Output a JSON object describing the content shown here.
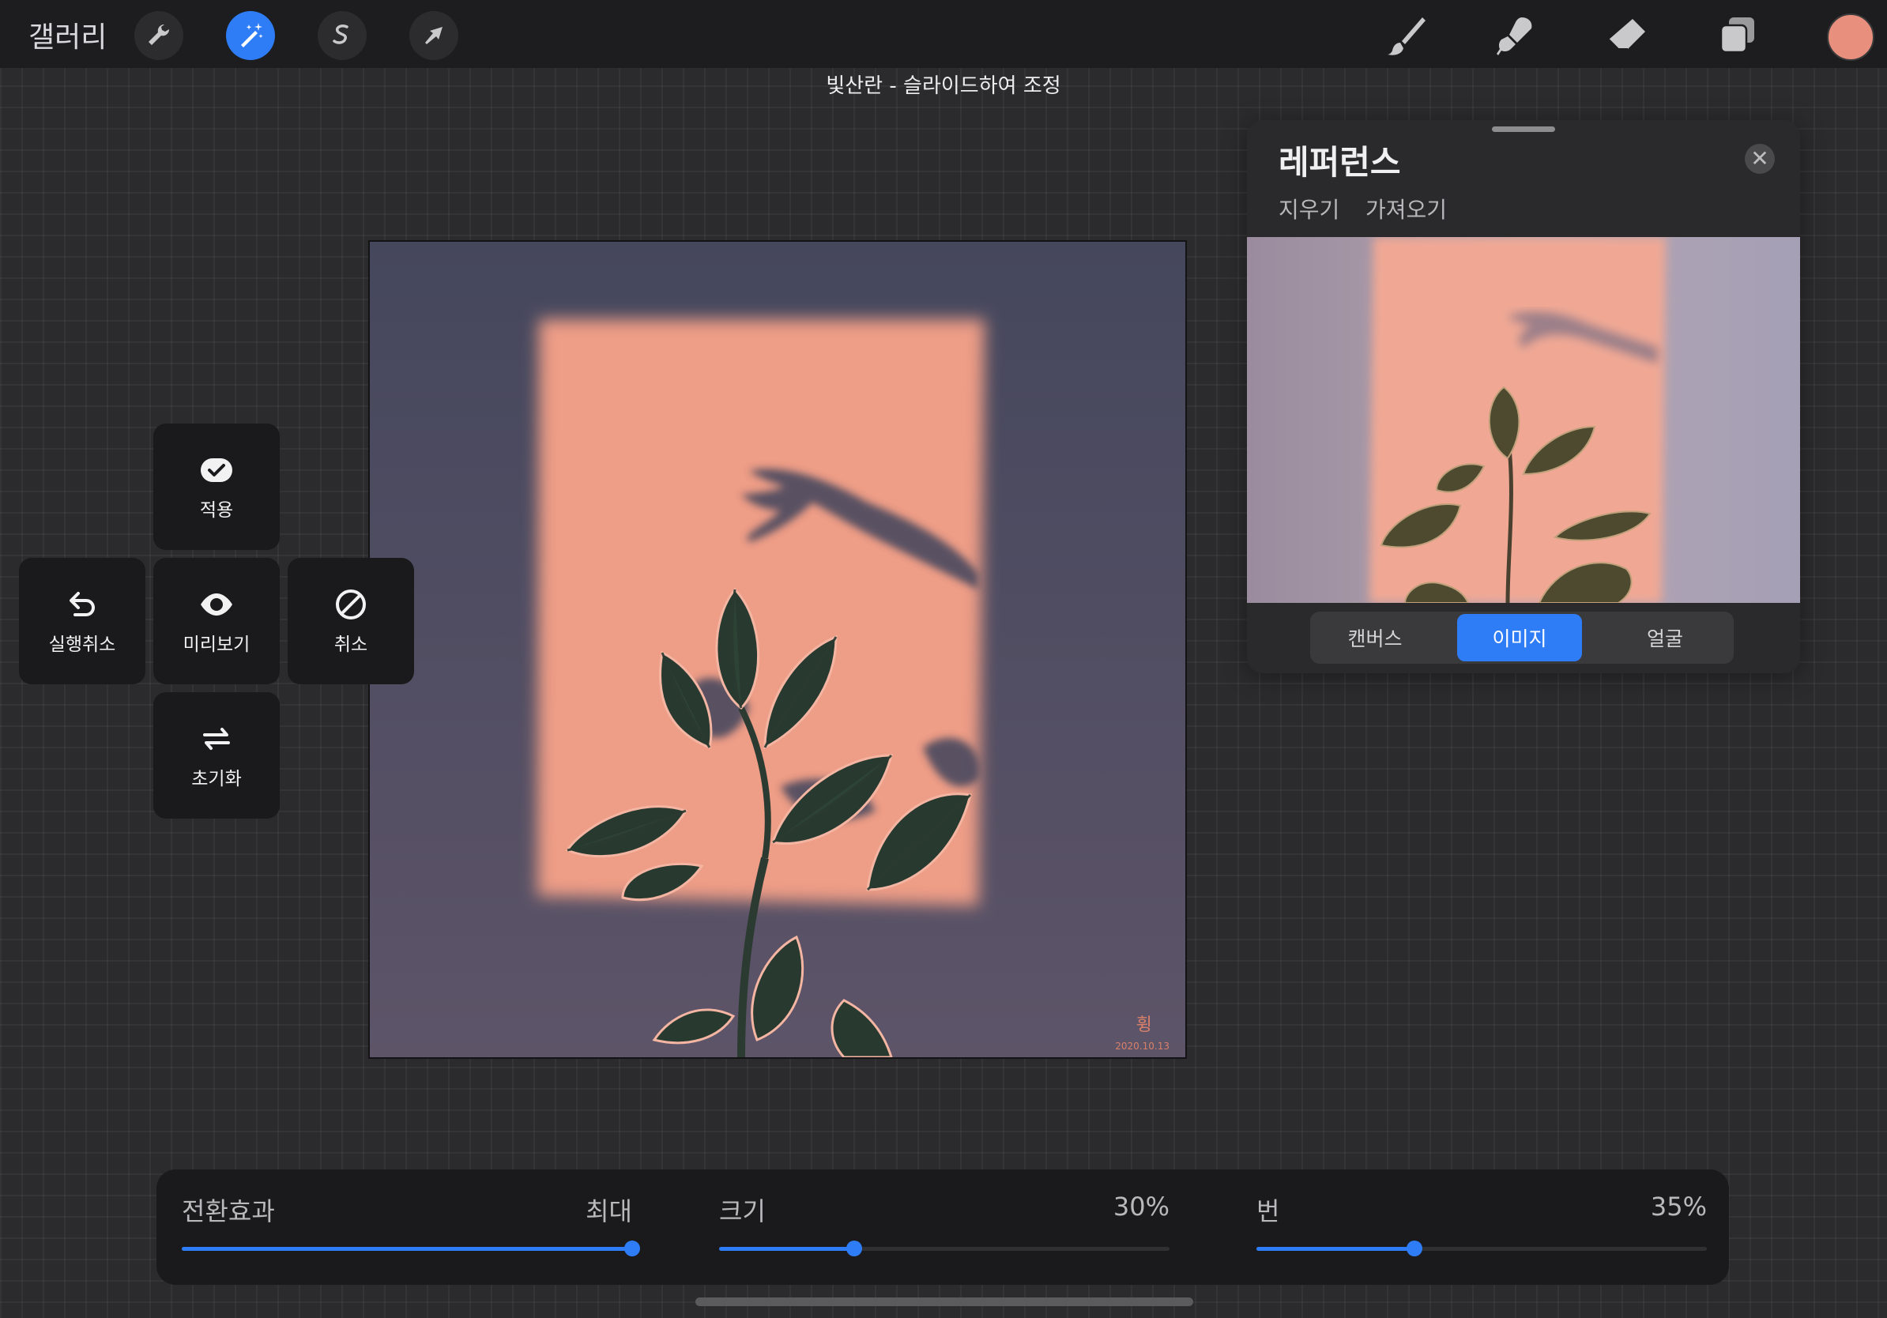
{
  "topbar": {
    "gallery_label": "갤러리",
    "tools": [
      "wrench-icon",
      "magic-wand-icon",
      "selection-icon",
      "transform-arrow-icon"
    ],
    "active_tool": "magic-wand-icon",
    "right_tools": [
      "brush-icon",
      "smudge-icon",
      "eraser-icon",
      "layers-icon"
    ],
    "current_color": "#e88f7e"
  },
  "hint": {
    "mode": "빛산란 -",
    "instruction": "슬라이드하여 조정"
  },
  "canvas": {
    "signature": "휭",
    "date": "2020.10.13"
  },
  "actions": {
    "apply": "적용",
    "undo": "실행취소",
    "preview": "미리보기",
    "cancel": "취소",
    "reset": "초기화"
  },
  "reference": {
    "title": "레퍼런스",
    "clear": "지우기",
    "import": "가져오기",
    "close_symbol": "✕",
    "tabs": [
      "캔버스",
      "이미지",
      "얼굴"
    ],
    "active_tab": "이미지"
  },
  "sliders": [
    {
      "name": "전환효과",
      "value_text": "최대",
      "fraction": 1.0
    },
    {
      "name": "크기",
      "value_text": "30%",
      "fraction": 0.3
    },
    {
      "name": "번",
      "value_text": "35%",
      "fraction": 0.35
    }
  ],
  "colors": {
    "accent": "#2f7df6",
    "toolbar_bg": "#1d1d1f",
    "canvas_bg": "#474861",
    "light_patch": "#ee9d86",
    "leaf": "#283a30"
  }
}
